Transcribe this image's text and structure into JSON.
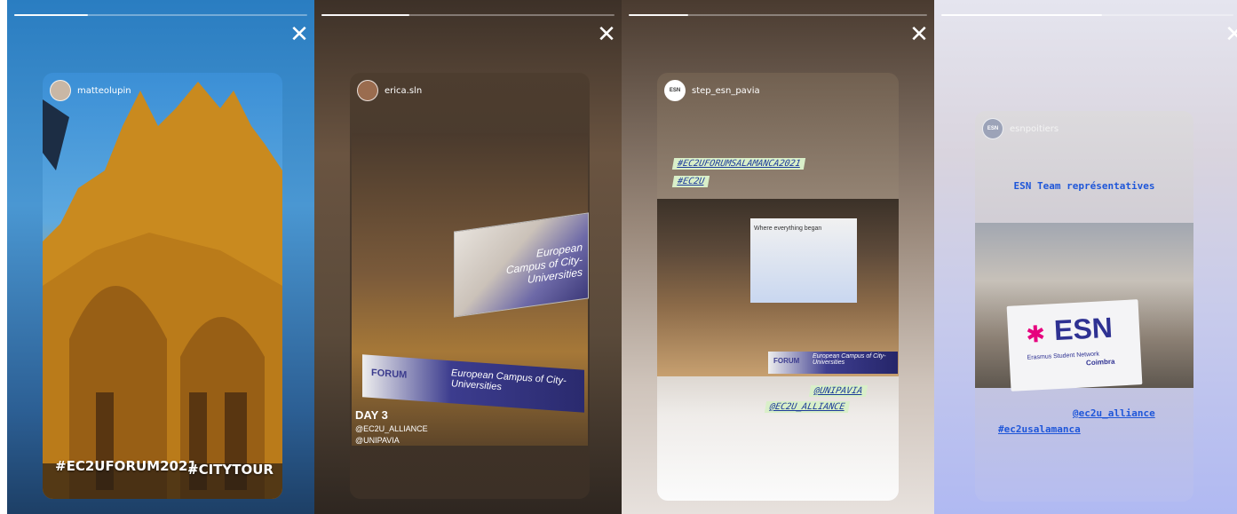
{
  "stories": [
    {
      "username": "matteolupin",
      "progress": 0.25,
      "tags": [
        "#EC2UFORUM2021",
        "#CITYTOUR"
      ]
    },
    {
      "username": "erica.sln",
      "progress": 0.3,
      "screen_text": "European Campus of City-Universities",
      "banner_left": "FORUM",
      "banner_text": "European Campus of City-Universities",
      "day": "DAY 3",
      "handles": [
        "@EC2U_ALLIANCE",
        "@UNIPAVIA"
      ]
    },
    {
      "username": "step_esn_pavia",
      "avatar_text": "ESN",
      "progress": 0.2,
      "hashtags_top": [
        "#EC2UFORUMSALAMANCA2021",
        "#EC2U"
      ],
      "hashtags_bottom": [
        "@UNIPAVIA",
        "@EC2U_ALLIANCE"
      ],
      "banner_left": "FORUM",
      "banner_text": "European Campus of City-Universities",
      "screen_text": "Where everything began"
    },
    {
      "username": "esnpoitiers",
      "avatar_text": "ESN",
      "progress": 0.55,
      "title": "ESN Team représentatives",
      "banner_logo": "ESN",
      "banner_sub": "Erasmus Student Network",
      "banner_city": "Coimbra",
      "hashtags": [
        "@ec2u_alliance",
        "#ec2usalamanca"
      ]
    }
  ],
  "close_label": "✕",
  "colors": {
    "hashtag_blue": "#1e56d9",
    "esn_magenta": "#e6007e",
    "esn_navy": "#2e3192",
    "hashtag_green": "#d9efc9"
  }
}
